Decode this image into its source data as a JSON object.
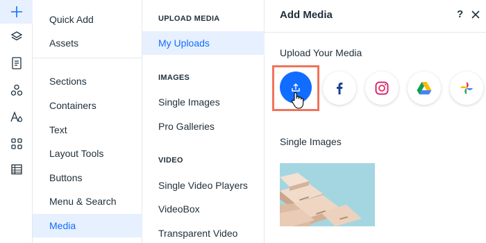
{
  "rail": {
    "icons": [
      "plus-icon",
      "layers-icon",
      "page-icon",
      "components-icon",
      "text-styles-icon",
      "apps-grid-icon",
      "table-icon"
    ],
    "accent": "#116dff"
  },
  "menu": {
    "items": [
      {
        "label": "Quick Add"
      },
      {
        "label": "Assets"
      },
      {
        "label": "Sections"
      },
      {
        "label": "Containers"
      },
      {
        "label": "Text"
      },
      {
        "label": "Layout Tools"
      },
      {
        "label": "Buttons"
      },
      {
        "label": "Menu & Search"
      },
      {
        "label": "Media",
        "active": true
      }
    ]
  },
  "submenu": {
    "upload_title": "UPLOAD MEDIA",
    "my_uploads": "My Uploads",
    "images_title": "IMAGES",
    "single_images": "Single Images",
    "pro_galleries": "Pro Galleries",
    "video_title": "VIDEO",
    "single_video_players": "Single Video Players",
    "videobox": "VideoBox",
    "transparent_video": "Transparent Video"
  },
  "panel": {
    "title": "Add Media",
    "help": "?",
    "upload_label": "Upload Your Media",
    "sources": [
      "upload-icon",
      "facebook-icon",
      "instagram-icon",
      "google-drive-icon",
      "google-photos-icon"
    ],
    "single_images_label": "Single Images",
    "highlight_color": "#f0735a",
    "thumbnail": "boxes-image"
  }
}
